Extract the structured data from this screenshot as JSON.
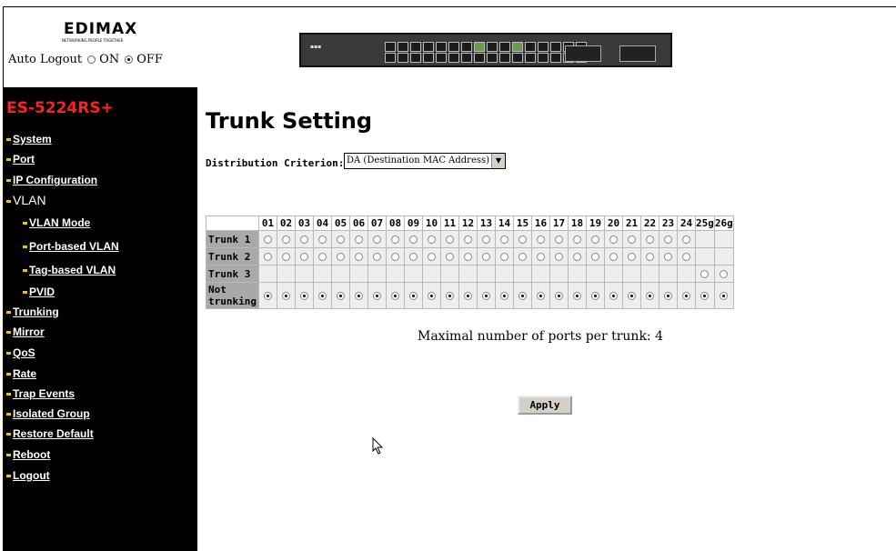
{
  "header": {
    "brand": "EDIMAX",
    "tagline": "NETWORKING PEOPLE TOGETHER",
    "auto_logout_label": "Auto Logout",
    "auto_logout_on": "ON",
    "auto_logout_off": "OFF",
    "auto_logout_selected": "OFF"
  },
  "sidebar": {
    "model": "ES-5224RS+",
    "items": [
      {
        "label": "System"
      },
      {
        "label": "Port"
      },
      {
        "label": "IP Configuration"
      },
      {
        "label": "VLAN"
      },
      {
        "label": "VLAN Mode"
      },
      {
        "label": "Port-based VLAN"
      },
      {
        "label": "Tag-based VLAN"
      },
      {
        "label": "PVID"
      },
      {
        "label": "Trunking"
      },
      {
        "label": "Mirror"
      },
      {
        "label": "QoS"
      },
      {
        "label": "Rate"
      },
      {
        "label": "Trap Events"
      },
      {
        "label": "Isolated Group"
      },
      {
        "label": "Restore Default"
      },
      {
        "label": "Reboot"
      },
      {
        "label": "Logout"
      }
    ]
  },
  "main": {
    "title": "Trunk Setting",
    "distribution_label": "Distribution Criterion:",
    "distribution_value": "DA (Destination MAC Address)",
    "ports": [
      "01",
      "02",
      "03",
      "04",
      "05",
      "06",
      "07",
      "08",
      "09",
      "10",
      "11",
      "12",
      "13",
      "14",
      "15",
      "16",
      "17",
      "18",
      "19",
      "20",
      "21",
      "22",
      "23",
      "24",
      "25g",
      "26g"
    ],
    "rows": [
      {
        "label": "Trunk 1",
        "ports": "1-24"
      },
      {
        "label": "Trunk 2",
        "ports": "1-24"
      },
      {
        "label": "Trunk 3",
        "ports": "25g-26g"
      },
      {
        "label": "Not trunking",
        "ports": "all"
      }
    ],
    "max_note": "Maximal number of ports per trunk: 4",
    "apply_label": "Apply"
  },
  "colors": {
    "sidebar_bg": "#000000",
    "model_color": "#ff2020",
    "header_cell": "#a9a9a9",
    "cell_bg": "#eeeeee"
  }
}
